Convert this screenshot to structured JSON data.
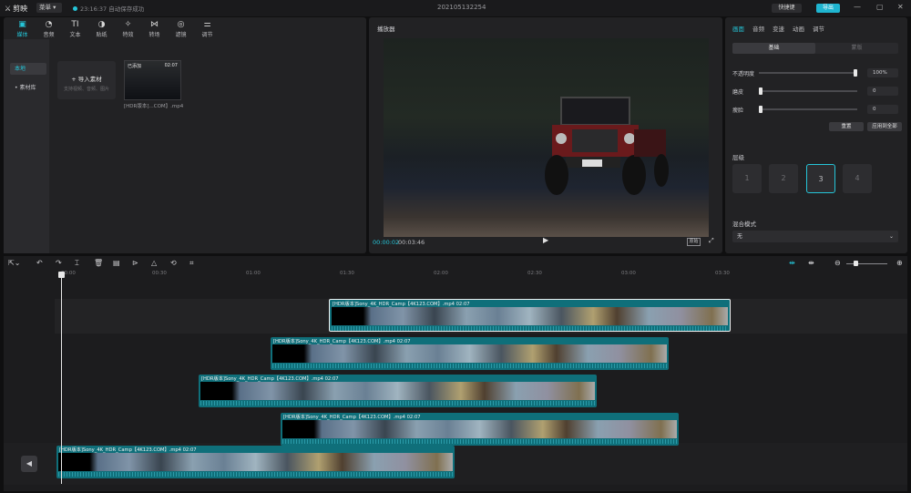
{
  "app": {
    "name": "剪映",
    "menu_label": "菜单",
    "save_status": "23:16:37 自动保存成功",
    "project_title": "202105132254",
    "shortcut_label": "快捷键",
    "export_label": "导出"
  },
  "media_tabs": [
    {
      "label": "媒体",
      "icon": "media-icon"
    },
    {
      "label": "音频",
      "icon": "audio-icon"
    },
    {
      "label": "文本",
      "icon": "text-icon"
    },
    {
      "label": "贴纸",
      "icon": "sticker-icon"
    },
    {
      "label": "特效",
      "icon": "effects-icon"
    },
    {
      "label": "转场",
      "icon": "transition-icon"
    },
    {
      "label": "滤镜",
      "icon": "filter-icon"
    },
    {
      "label": "调节",
      "icon": "adjust-icon"
    }
  ],
  "media_side": {
    "local": "本地",
    "library": "素材库"
  },
  "import": {
    "title": "导入素材",
    "hint": "支持视频、音频、图片"
  },
  "media_clip": {
    "tag": "已添加",
    "duration": "02:07",
    "name": "[HDR版本]...COM】.mp4"
  },
  "player": {
    "title": "播放器",
    "current_time": "00:00:02",
    "total_time": "00:03:46",
    "original_label": "原始"
  },
  "props": {
    "tabs": [
      "画面",
      "音频",
      "变速",
      "动画",
      "调节"
    ],
    "seg_on": "基础",
    "seg_off": "蒙版",
    "opacity_label": "不透明度",
    "opacity_value": "100%",
    "opacity_level": 1.0,
    "smooth_label": "磨皮",
    "smooth_value": "0",
    "thin_label": "瘦脸",
    "thin_value": "0",
    "reset_label": "重置",
    "apply_all_label": "应用到全部",
    "layer_label": "层级",
    "layers": [
      "1",
      "2",
      "3",
      "4"
    ],
    "active_layer": "3",
    "blend_label": "混合模式",
    "blend_value": "无"
  },
  "ruler_ticks": [
    "00:00",
    "00:30",
    "01:00",
    "01:30",
    "02:00",
    "02:30",
    "03:00",
    "03:30"
  ],
  "clips": [
    {
      "label": "[HDR版本]Sony_4K_HDR_Camp【4K123.COM】.mp4    02:07"
    },
    {
      "label": "[HDR版本]Sony_4K_HDR_Camp【4K123.COM】.mp4    02:07"
    },
    {
      "label": "[HDR版本]Sony_4K_HDR_Camp【4K123.COM】.mp4    02:07"
    },
    {
      "label": "[HDR版本]Sony_4K_HDR_Camp【4K123.COM】.mp4    02:07"
    },
    {
      "label": "[HDR版本]Sony_4K_HDR_Camp【4K123.COM】.mp4    02:07"
    }
  ]
}
